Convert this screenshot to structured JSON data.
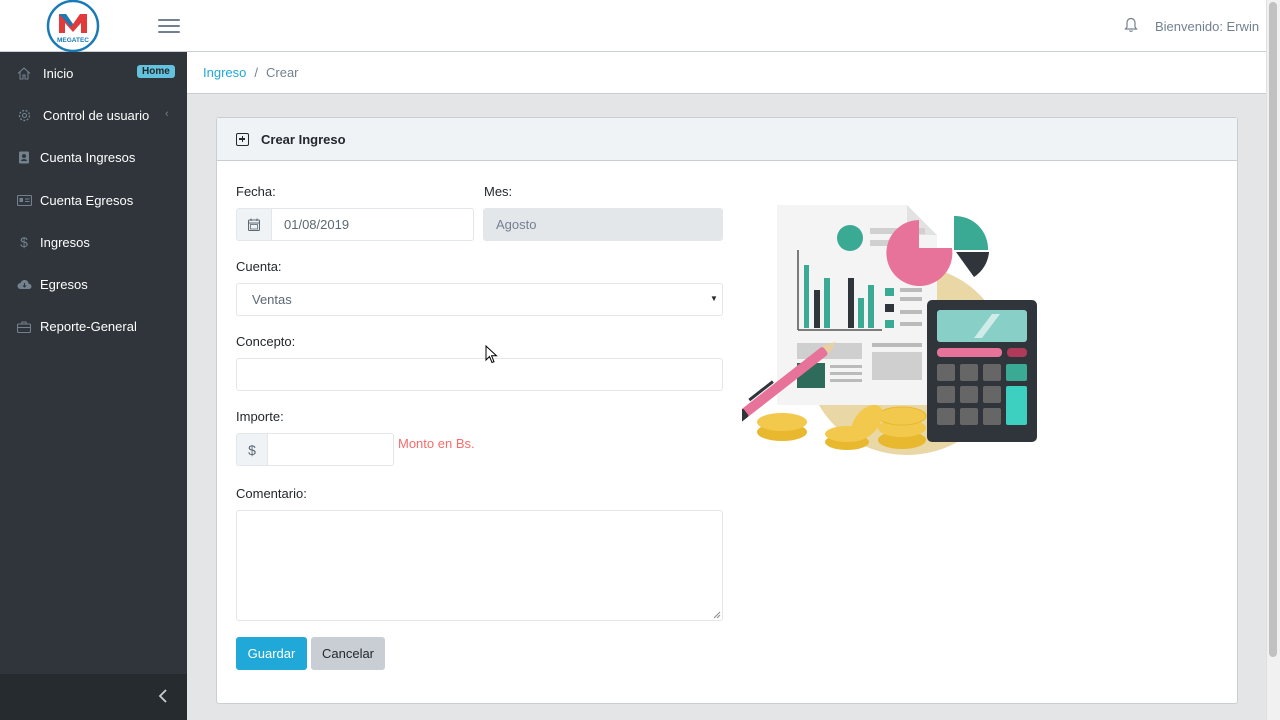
{
  "header": {
    "logo_text": "MEGATEC",
    "welcome": "Bienvenido: Erwin"
  },
  "sidebar": {
    "items": [
      {
        "label": "Inicio",
        "icon": "home-icon",
        "badge": "Home"
      },
      {
        "label": "Control de usuario",
        "icon": "gear-icon",
        "caret": "‹"
      },
      {
        "label": "Cuenta Ingresos",
        "icon": "contact-book-icon"
      },
      {
        "label": "Cuenta Egresos",
        "icon": "id-card-icon"
      },
      {
        "label": "Ingresos",
        "icon": "dollar-icon"
      },
      {
        "label": "Egresos",
        "icon": "cloud-icon"
      },
      {
        "label": "Reporte-General",
        "icon": "briefcase-icon"
      }
    ]
  },
  "breadcrumb": {
    "parent": "Ingreso",
    "separator": "/",
    "current": "Crear"
  },
  "card": {
    "title": "Crear Ingreso"
  },
  "form": {
    "fecha_label": "Fecha:",
    "fecha_value": "01/08/2019",
    "mes_label": "Mes:",
    "mes_value": "Agosto",
    "cuenta_label": "Cuenta:",
    "cuenta_value": "Ventas",
    "concepto_label": "Concepto:",
    "concepto_value": "",
    "importe_label": "Importe:",
    "importe_prefix": "$",
    "importe_value": "",
    "importe_hint": "Monto en Bs.",
    "comentario_label": "Comentario:",
    "comentario_value": "",
    "save_label": "Guardar",
    "cancel_label": "Cancelar"
  },
  "colors": {
    "primary": "#20a8d8",
    "sidebar_bg": "#2f353a",
    "badge": "#63c2de",
    "hint": "#f86c6b"
  }
}
